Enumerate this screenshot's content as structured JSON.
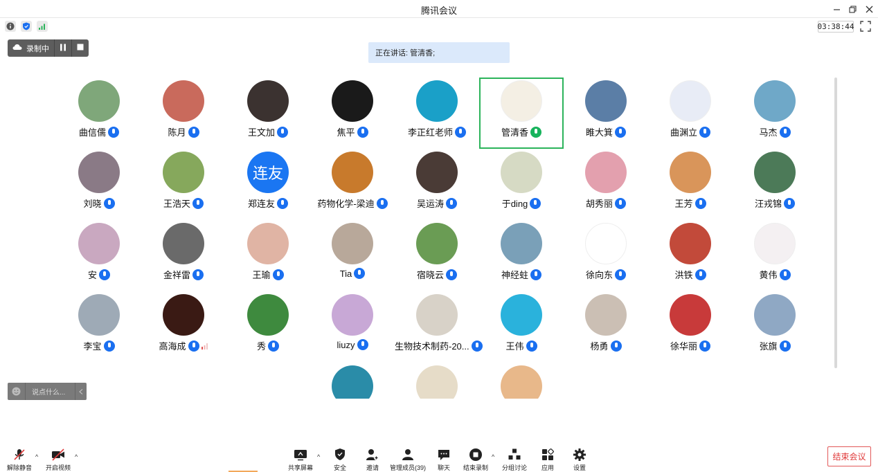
{
  "window": {
    "title": "腾讯会议",
    "timer": "03:38:44"
  },
  "recording": {
    "label": "录制中"
  },
  "speaking": {
    "text": "正在讲话: 管清香;"
  },
  "participants": [
    {
      "name": "曲信儒",
      "bg": "#7fa77a"
    },
    {
      "name": "陈月",
      "bg": "#c96a5c"
    },
    {
      "name": "王文加",
      "bg": "#3b3230"
    },
    {
      "name": "焦平",
      "bg": "#1a1a1a"
    },
    {
      "name": "李正红老师",
      "bg": "#1aa0c8"
    },
    {
      "name": "管清香",
      "bg": "#f4efe4",
      "speaking": true
    },
    {
      "name": "睢大箕",
      "bg": "#5b7ea6"
    },
    {
      "name": "曲渊立",
      "bg": "#e8ecf6"
    },
    {
      "name": "马杰",
      "bg": "#6fa8c8"
    },
    {
      "name": "刘晓",
      "bg": "#8a7a86"
    },
    {
      "name": "王浩天",
      "bg": "#86a85c"
    },
    {
      "name": "郑连友",
      "bg": "#1a76f2",
      "initials": "连友"
    },
    {
      "name": "药物化学-梁迪",
      "bg": "#c87a2c"
    },
    {
      "name": "吴运涛",
      "bg": "#4a3b36"
    },
    {
      "name": "于ding",
      "bg": "#d6dac4"
    },
    {
      "name": "胡秀丽",
      "bg": "#e3a0ae"
    },
    {
      "name": "王芳",
      "bg": "#d9955a"
    },
    {
      "name": "汪戎锦",
      "bg": "#4c7a58"
    },
    {
      "name": "安",
      "bg": "#c9a8c0"
    },
    {
      "name": "金祥雷",
      "bg": "#6a6a6a"
    },
    {
      "name": "王瑜",
      "bg": "#e0b4a4"
    },
    {
      "name": "Tia",
      "bg": "#b8a89a"
    },
    {
      "name": "宿晓云",
      "bg": "#6a9c54"
    },
    {
      "name": "神经蛀",
      "bg": "#7aa0b8"
    },
    {
      "name": "徐向东",
      "bg": "#ffffff"
    },
    {
      "name": "洪铁",
      "bg": "#c24a3a"
    },
    {
      "name": "黄伟",
      "bg": "#f4f0f2"
    },
    {
      "name": "李宝",
      "bg": "#9eaab6"
    },
    {
      "name": "高海成",
      "bg": "#3a1a14",
      "signal": true
    },
    {
      "name": "秀",
      "bg": "#3e8a3e"
    },
    {
      "name": "liuzy",
      "bg": "#c8a8d6"
    },
    {
      "name": "生物技术制药-20...",
      "bg": "#d8d2c8"
    },
    {
      "name": "王伟",
      "bg": "#2ab2dc"
    },
    {
      "name": "杨勇",
      "bg": "#cbbfb4"
    },
    {
      "name": "徐华丽",
      "bg": "#c83a3a"
    },
    {
      "name": "张旗",
      "bg": "#8fa8c4"
    },
    {
      "name": "",
      "bg": "#2a8ca8"
    },
    {
      "name": "",
      "bg": "#e6dcc8"
    },
    {
      "name": "",
      "bg": "#e8b88a"
    }
  ],
  "chat": {
    "placeholder": "说点什么..."
  },
  "toolbar": {
    "unmute": "解除静音",
    "video": "开启视频",
    "share": "共享屏幕",
    "security": "安全",
    "invite": "邀请",
    "members": "管理成员(39)",
    "chat": "聊天",
    "record": "结束录制",
    "breakout": "分组讨论",
    "apps": "应用",
    "settings": "设置",
    "end": "结束会议"
  }
}
